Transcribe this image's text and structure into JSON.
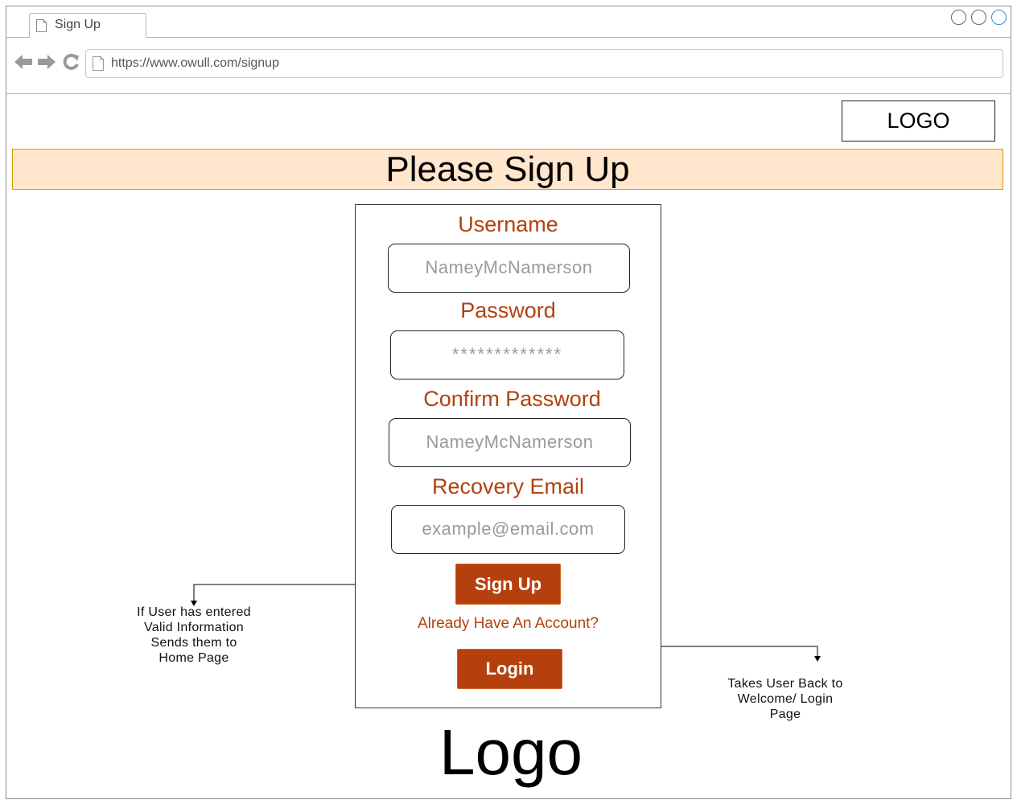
{
  "browser": {
    "tab_label": "Sign Up",
    "url": "https://www.owull.com/signup",
    "icons": [
      "back-arrow-icon",
      "forward-arrow-icon",
      "reload-icon",
      "page-icon"
    ]
  },
  "header": {
    "logo_label": "LOGO",
    "banner_title": "Please Sign Up"
  },
  "form": {
    "username_label": "Username",
    "username_value": "NameyMcNamerson",
    "password_label": "Password",
    "password_value": "*************",
    "confirm_label": "Confirm Password",
    "confirm_value": "NameyMcNamerson",
    "email_label": "Recovery Email",
    "email_value": "example@email.com",
    "signup_button": "Sign Up",
    "account_prompt": "Already Have An Account?",
    "login_button": "Login"
  },
  "annotations": {
    "signup_note": [
      "If User has entered",
      "Valid Information",
      "Sends them to",
      "Home Page"
    ],
    "login_note": [
      "Takes User Back to",
      "Welcome/ Login",
      "Page"
    ]
  },
  "footer": {
    "logo_text": "Logo"
  },
  "colors": {
    "accent": "#b5400e",
    "label": "#b2410f",
    "banner_fill": "#ffe6cc",
    "banner_border": "#d79b00"
  }
}
